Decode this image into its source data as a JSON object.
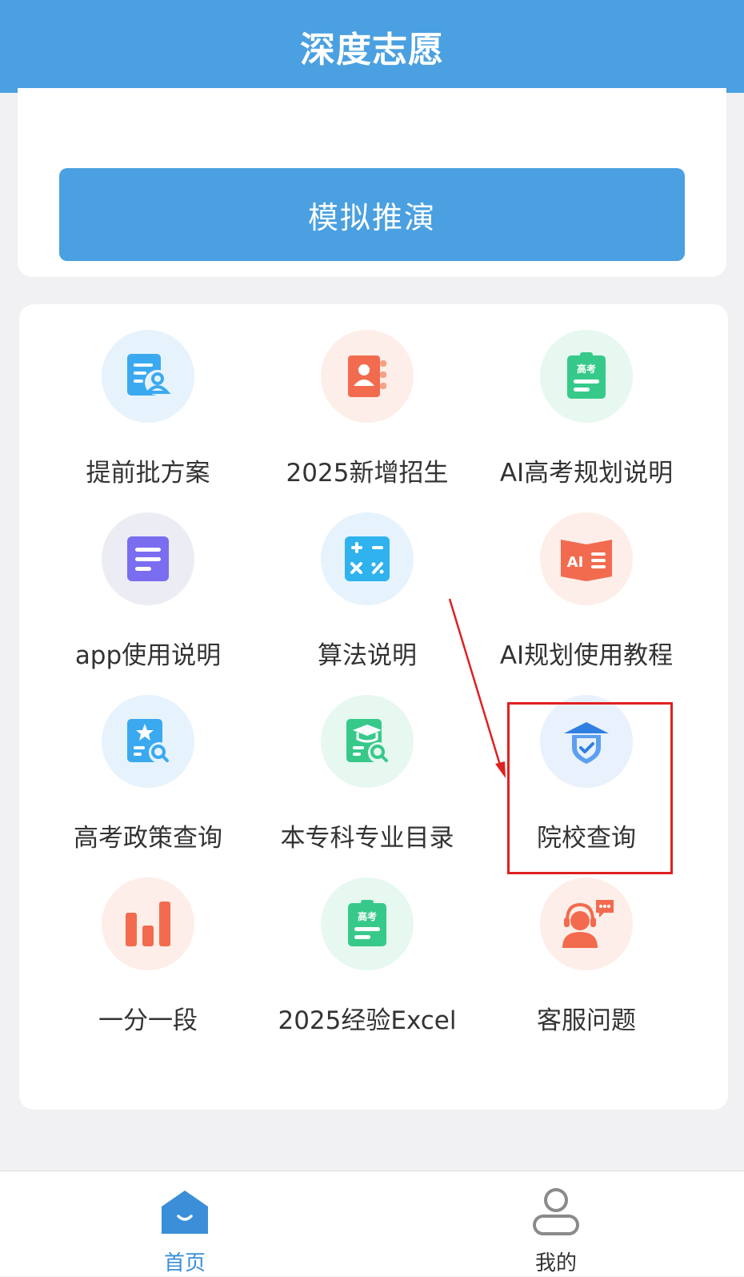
{
  "header": {
    "title": "深度志愿"
  },
  "top_card": {
    "simulate_button_label": "模拟推演"
  },
  "menu": {
    "items": [
      {
        "label": "提前批方案",
        "icon": "document-user-icon"
      },
      {
        "label": "2025新增招生",
        "icon": "contact-book-icon"
      },
      {
        "label": "AI高考规划说明",
        "icon": "exam-clipboard-icon",
        "icon_text": "高考"
      },
      {
        "label": "app使用说明",
        "icon": "document-lines-icon"
      },
      {
        "label": "算法说明",
        "icon": "calculator-icon"
      },
      {
        "label": "AI规划使用教程",
        "icon": "ai-book-icon",
        "icon_text": "AI"
      },
      {
        "label": "高考政策查询",
        "icon": "star-search-doc-icon"
      },
      {
        "label": "本专科专业目录",
        "icon": "graduation-doc-icon"
      },
      {
        "label": "院校查询",
        "icon": "school-shield-icon"
      },
      {
        "label": "一分一段",
        "icon": "bar-chart-icon"
      },
      {
        "label": "2025经验Excel",
        "icon": "exam-clipboard-icon",
        "icon_text": "高考"
      },
      {
        "label": "客服问题",
        "icon": "customer-service-icon"
      }
    ]
  },
  "annotation": {
    "highlighted_item": "院校查询"
  },
  "bottom_nav": {
    "home_label": "首页",
    "profile_label": "我的",
    "active": "首页"
  },
  "colors": {
    "primary": "#4aa0e0",
    "background": "#f1f1f3",
    "annotation_red": "#e02020"
  }
}
